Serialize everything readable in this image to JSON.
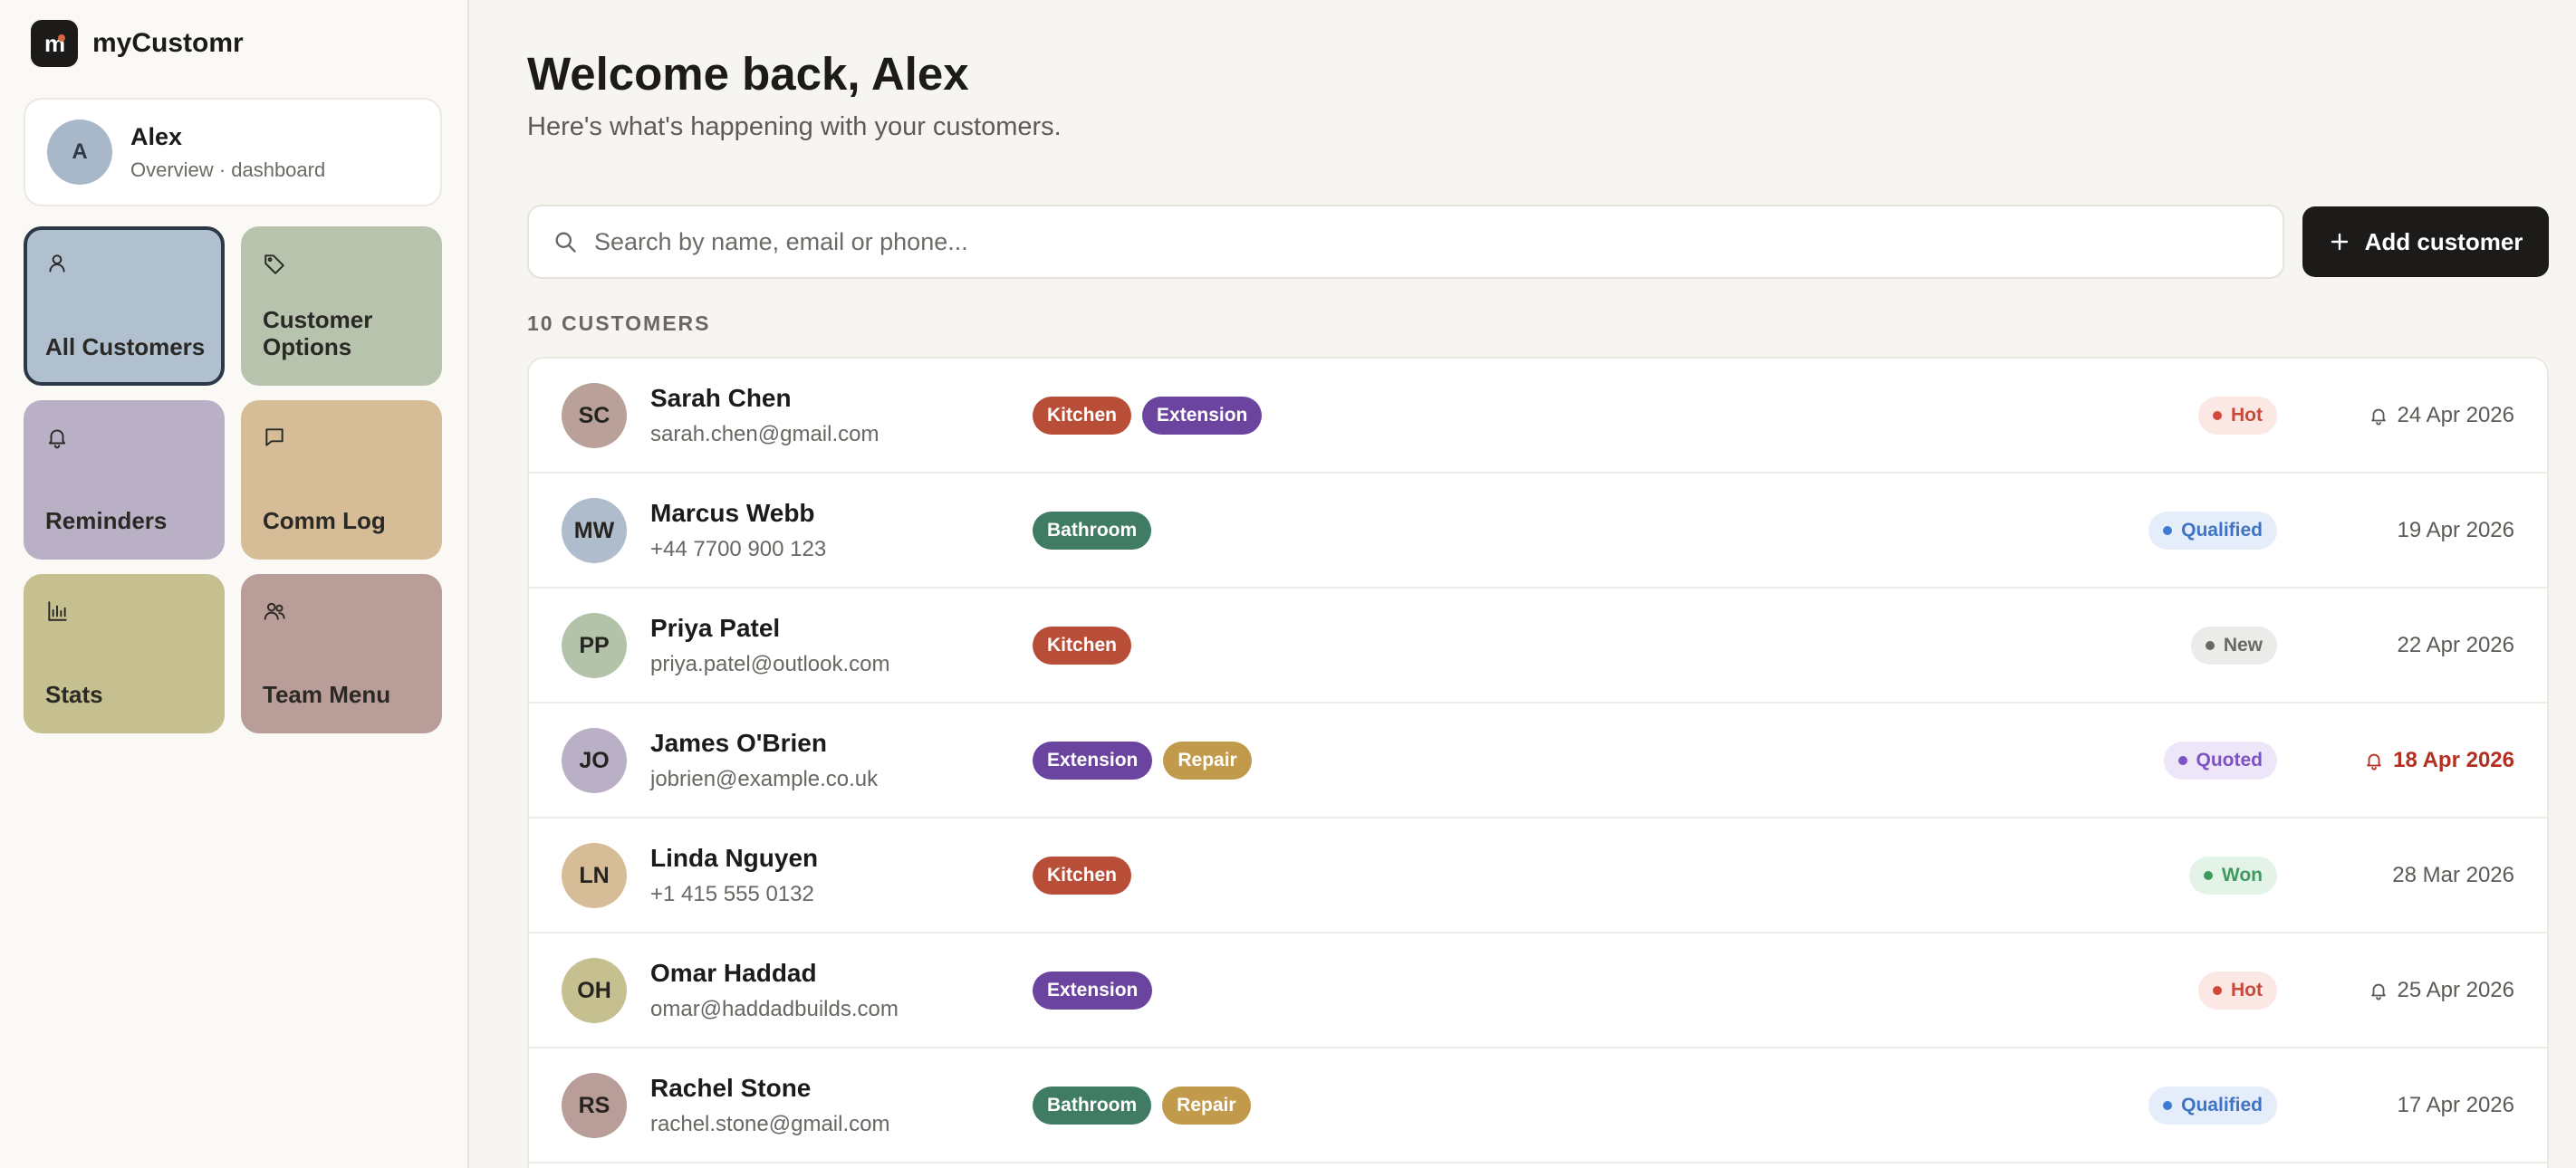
{
  "brand": {
    "name": "myCustomr",
    "logo_letter": "m"
  },
  "profile": {
    "initial": "A",
    "name": "Alex",
    "subtitle": "Overview · dashboard"
  },
  "nav": [
    {
      "label": "All Customers",
      "icon": "user-icon",
      "color": "#b1c0cf",
      "active": true
    },
    {
      "label": "Customer Options",
      "icon": "tag-icon",
      "color": "#b7c3ad",
      "active": false
    },
    {
      "label": "Reminders",
      "icon": "bell-icon",
      "color": "#b9b0c6",
      "active": false
    },
    {
      "label": "Comm Log",
      "icon": "chat-icon",
      "color": "#d7bd97",
      "active": false
    },
    {
      "label": "Stats",
      "icon": "bar-chart-icon",
      "color": "#c6bf8f",
      "active": false
    },
    {
      "label": "Team Menu",
      "icon": "team-icon",
      "color": "#b89d98",
      "active": false
    }
  ],
  "header": {
    "title": "Welcome back, Alex",
    "subtitle": "Here's what's happening with your customers."
  },
  "search": {
    "placeholder": "Search by name, email or phone...",
    "value": ""
  },
  "add_button": {
    "label": "Add customer"
  },
  "count_label": "10 CUSTOMERS",
  "tag_colors": {
    "Kitchen": "#b84e37",
    "Extension": "#6a449e",
    "Bathroom": "#3f7c63",
    "Repair": "#c19a4c"
  },
  "status_styles": {
    "Hot": {
      "bg": "#fbe8e4",
      "fg": "#c9493a",
      "dot": "#d4483a"
    },
    "Qualified": {
      "bg": "#e4edf9",
      "fg": "#3f74c4",
      "dot": "#3f7ad4"
    },
    "New": {
      "bg": "#ebebe9",
      "fg": "#6a6864",
      "dot": "#6a6864"
    },
    "Quoted": {
      "bg": "#ede6f9",
      "fg": "#7d52c2",
      "dot": "#7d52c2"
    },
    "Won": {
      "bg": "#e3f3e8",
      "fg": "#3f9a5e",
      "dot": "#3f9a5e"
    }
  },
  "customers": [
    {
      "initials": "SC",
      "avatar_color": "#b9a199",
      "name": "Sarah Chen",
      "contact": "sarah.chen@gmail.com",
      "tags": [
        "Kitchen",
        "Extension"
      ],
      "status": "Hot",
      "date": "24 Apr 2026",
      "reminder": true,
      "overdue": false
    },
    {
      "initials": "MW",
      "avatar_color": "#aebccb",
      "name": "Marcus Webb",
      "contact": "+44 7700 900 123",
      "tags": [
        "Bathroom"
      ],
      "status": "Qualified",
      "date": "19 Apr 2026",
      "reminder": false,
      "overdue": false
    },
    {
      "initials": "PP",
      "avatar_color": "#b3c3a9",
      "name": "Priya Patel",
      "contact": "priya.patel@outlook.com",
      "tags": [
        "Kitchen"
      ],
      "status": "New",
      "date": "22 Apr 2026",
      "reminder": false,
      "overdue": false
    },
    {
      "initials": "JO",
      "avatar_color": "#b9b0c6",
      "name": "James O'Brien",
      "contact": "jobrien@example.co.uk",
      "tags": [
        "Extension",
        "Repair"
      ],
      "status": "Quoted",
      "date": "18 Apr 2026",
      "reminder": true,
      "overdue": true
    },
    {
      "initials": "LN",
      "avatar_color": "#d7bd97",
      "name": "Linda Nguyen",
      "contact": "+1 415 555 0132",
      "tags": [
        "Kitchen"
      ],
      "status": "Won",
      "date": "28 Mar 2026",
      "reminder": false,
      "overdue": false
    },
    {
      "initials": "OH",
      "avatar_color": "#c6bf8f",
      "name": "Omar Haddad",
      "contact": "omar@haddadbuilds.com",
      "tags": [
        "Extension"
      ],
      "status": "Hot",
      "date": "25 Apr 2026",
      "reminder": true,
      "overdue": false
    },
    {
      "initials": "RS",
      "avatar_color": "#b89d98",
      "name": "Rachel Stone",
      "contact": "rachel.stone@gmail.com",
      "tags": [
        "Bathroom",
        "Repair"
      ],
      "status": "Qualified",
      "date": "17 Apr 2026",
      "reminder": false,
      "overdue": false
    }
  ]
}
